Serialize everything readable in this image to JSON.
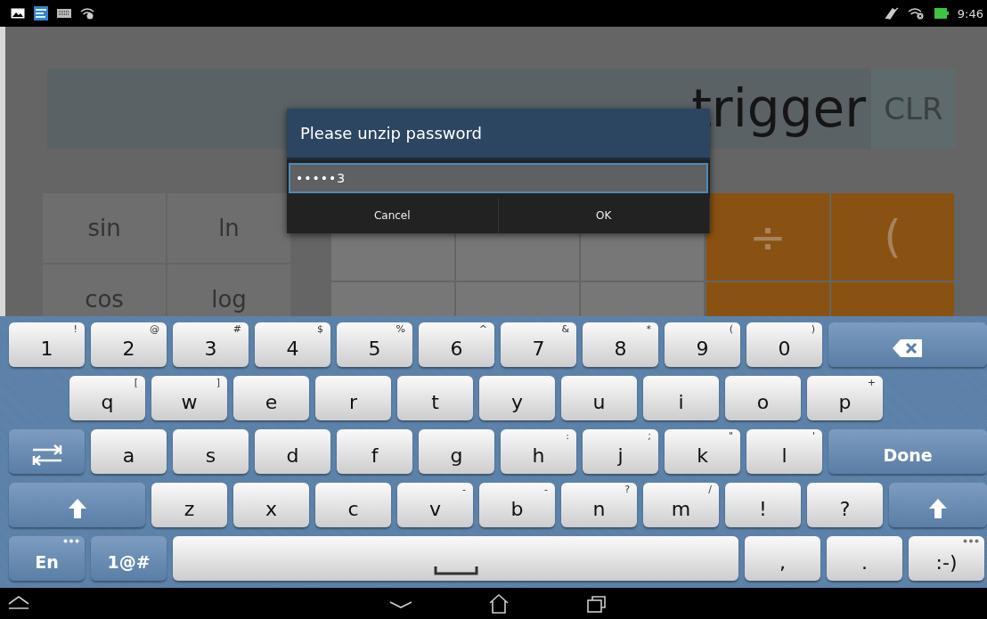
{
  "status_bar": {
    "time": "9:46"
  },
  "calculator": {
    "display": "trigger",
    "clear_button": "CLR",
    "function_keys": [
      "sin",
      "ln",
      "cos",
      "log"
    ],
    "operator_keys": [
      "÷",
      "("
    ]
  },
  "dialog": {
    "title": "Please unzip password",
    "value": "•••••3",
    "buttons": [
      "Cancel",
      "OK"
    ]
  },
  "keyboard": {
    "rows": [
      [
        {
          "kind": "char",
          "label": "1",
          "alt": "!"
        },
        {
          "kind": "char",
          "label": "2",
          "alt": "@"
        },
        {
          "kind": "char",
          "label": "3",
          "alt": "#"
        },
        {
          "kind": "char",
          "label": "4",
          "alt": "$"
        },
        {
          "kind": "char",
          "label": "5",
          "alt": "%"
        },
        {
          "kind": "char",
          "label": "6",
          "alt": "^"
        },
        {
          "kind": "char",
          "label": "7",
          "alt": "&"
        },
        {
          "kind": "char",
          "label": "8",
          "alt": "*"
        },
        {
          "kind": "char",
          "label": "9",
          "alt": "("
        },
        {
          "kind": "char",
          "label": "0",
          "alt": ")"
        },
        {
          "kind": "backspace"
        }
      ],
      [
        {
          "kind": "char",
          "label": "q",
          "alt": "["
        },
        {
          "kind": "char",
          "label": "w",
          "alt": "]"
        },
        {
          "kind": "char",
          "label": "e"
        },
        {
          "kind": "char",
          "label": "r"
        },
        {
          "kind": "char",
          "label": "t"
        },
        {
          "kind": "char",
          "label": "y"
        },
        {
          "kind": "char",
          "label": "u"
        },
        {
          "kind": "char",
          "label": "i"
        },
        {
          "kind": "char",
          "label": "o"
        },
        {
          "kind": "char",
          "label": "p",
          "alt": "+"
        }
      ],
      [
        {
          "kind": "tab"
        },
        {
          "kind": "char",
          "label": "a"
        },
        {
          "kind": "char",
          "label": "s"
        },
        {
          "kind": "char",
          "label": "d"
        },
        {
          "kind": "char",
          "label": "f"
        },
        {
          "kind": "char",
          "label": "g"
        },
        {
          "kind": "char",
          "label": "h",
          "alt": ":"
        },
        {
          "kind": "char",
          "label": "j",
          "alt": ";"
        },
        {
          "kind": "char",
          "label": "k",
          "alt": "\""
        },
        {
          "kind": "char",
          "label": "l",
          "alt": "'"
        },
        {
          "kind": "action",
          "label": "Done"
        }
      ],
      [
        {
          "kind": "shift"
        },
        {
          "kind": "char",
          "label": "z"
        },
        {
          "kind": "char",
          "label": "x"
        },
        {
          "kind": "char",
          "label": "c"
        },
        {
          "kind": "char",
          "label": "v",
          "alt": "-"
        },
        {
          "kind": "char",
          "label": "b",
          "alt": "-"
        },
        {
          "kind": "char",
          "label": "n",
          "alt": "?"
        },
        {
          "kind": "char",
          "label": "m",
          "alt": "/"
        },
        {
          "kind": "char",
          "label": "!"
        },
        {
          "kind": "char",
          "label": "?"
        },
        {
          "kind": "shift"
        }
      ],
      [
        {
          "kind": "mode",
          "label": "En",
          "more": true
        },
        {
          "kind": "mode",
          "label": "1@#",
          "more": false
        },
        {
          "kind": "space"
        },
        {
          "kind": "char",
          "label": ","
        },
        {
          "kind": "char",
          "label": "."
        },
        {
          "kind": "char",
          "label": ":-)",
          "more": true
        }
      ]
    ]
  }
}
